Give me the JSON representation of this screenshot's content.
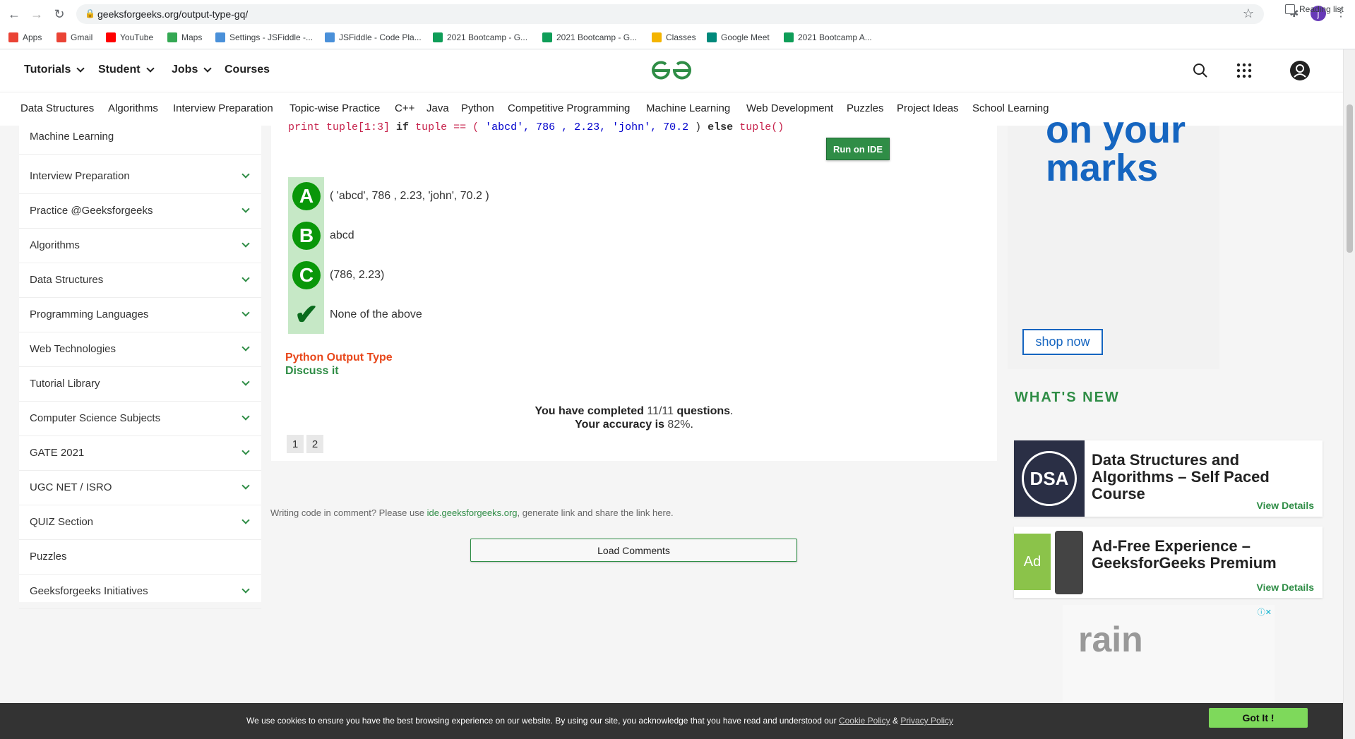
{
  "browser": {
    "url": "geeksforgeeks.org/output-type-gq/",
    "avatar_letter": "j",
    "bookmarks": [
      {
        "label": "Apps",
        "color": "#ea4335"
      },
      {
        "label": "Gmail",
        "color": "#ea4335"
      },
      {
        "label": "YouTube",
        "color": "#ff0000"
      },
      {
        "label": "Maps",
        "color": "#34a853"
      },
      {
        "label": "Settings - JSFiddle -...",
        "color": "#4a90d9"
      },
      {
        "label": "JSFiddle - Code Pla...",
        "color": "#4a90d9"
      },
      {
        "label": "2021 Bootcamp - G...",
        "color": "#0f9d58"
      },
      {
        "label": "2021 Bootcamp - G...",
        "color": "#0f9d58"
      },
      {
        "label": "Classes",
        "color": "#f4b400"
      },
      {
        "label": "Google Meet",
        "color": "#00897b"
      },
      {
        "label": "2021 Bootcamp A...",
        "color": "#0f9d58"
      }
    ],
    "reading_list": "Reading list"
  },
  "header": {
    "menus": [
      "Tutorials",
      "Student",
      "Jobs",
      "Courses"
    ],
    "logo": "GfG"
  },
  "subnav": [
    "Data Structures",
    "Algorithms",
    "Interview Preparation",
    "Topic-wise Practice",
    "C++",
    "Java",
    "Python",
    "Competitive Programming",
    "Machine Learning",
    "Web Development",
    "Puzzles",
    "Project Ideas",
    "School Learning"
  ],
  "sidebar": {
    "items": [
      {
        "label": "Machine Learning",
        "chevron": false
      },
      {
        "label": "Interview Preparation",
        "chevron": true
      },
      {
        "label": "Practice @Geeksforgeeks",
        "chevron": true
      },
      {
        "label": "Algorithms",
        "chevron": true
      },
      {
        "label": "Data Structures",
        "chevron": true
      },
      {
        "label": "Programming Languages",
        "chevron": true
      },
      {
        "label": "Web Technologies",
        "chevron": true
      },
      {
        "label": "Tutorial Library",
        "chevron": true
      },
      {
        "label": "Computer Science Subjects",
        "chevron": true
      },
      {
        "label": "GATE 2021",
        "chevron": true
      },
      {
        "label": "UGC NET / ISRO",
        "chevron": true
      },
      {
        "label": "QUIZ Section",
        "chevron": true
      },
      {
        "label": "Puzzles",
        "chevron": false
      },
      {
        "label": "Geeksforgeeks Initiatives",
        "chevron": true
      }
    ]
  },
  "question": {
    "code_kw_print": "print",
    "code_rest": " tuple[1:3] ",
    "code_if": "if",
    "code_mid": " tuple == ( ",
    "code_args": "'abcd', 786 , 2.23, 'john', 70.2 ",
    "code_close": ") ",
    "code_else": "else",
    "code_end": " tuple()",
    "run_label": "Run on IDE",
    "options": [
      {
        "letter": "A",
        "text": "( 'abcd', 786 , 2.23, 'john', 70.2 )"
      },
      {
        "letter": "B",
        "text": "abcd"
      },
      {
        "letter": "C",
        "text": "(786, 2.23)"
      },
      {
        "letter": "✔",
        "text": "None of the above"
      }
    ],
    "topic_link": "Python Output Type",
    "discuss_link": "Discuss it",
    "completed_prefix": "You have completed ",
    "completed_value": "11/11",
    "completed_suffix": " questions",
    "accuracy_prefix": "Your accuracy is ",
    "accuracy_value": "82%",
    "pages": [
      "1",
      "2"
    ]
  },
  "comments": {
    "note_prefix": "Writing code in comment? Please use ",
    "note_link": "ide.geeksforgeeks.org",
    "note_suffix": ", generate link and share the link here.",
    "load_label": "Load Comments"
  },
  "right": {
    "ad_line1": "on your",
    "ad_line2": "marks",
    "ad_button": "shop now",
    "whats_new": "WHAT'S NEW",
    "cards": [
      {
        "title": "Data Structures and Algorithms – Self Paced Course",
        "thumb": "DSA",
        "link": "View Details"
      },
      {
        "title": "Ad-Free Experience – GeeksforGeeks Premium",
        "thumb": "Ad",
        "link": "View Details"
      }
    ],
    "ad2_text": "rain"
  },
  "cookie": {
    "text": "We use cookies to ensure you have the best browsing experience on our website. By using our site, you acknowledge that you have read and understood our ",
    "policy": "Cookie Policy",
    "amp": " & ",
    "privacy": "Privacy Policy",
    "button": "Got It !"
  }
}
